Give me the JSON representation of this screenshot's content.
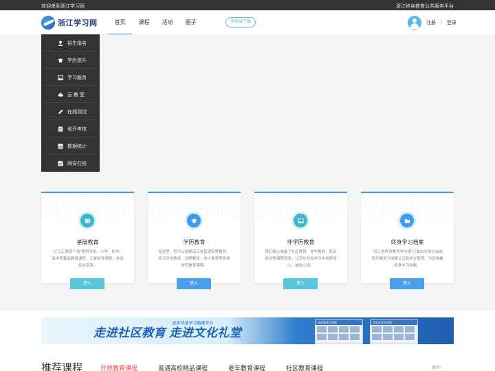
{
  "topbar": {
    "welcome": "欢迎来到浙江学习网",
    "platform": "浙江终身教育公共服务平台"
  },
  "header": {
    "logo_text": "浙江学习网",
    "nav": [
      "首页",
      "课程",
      "活动",
      "圈子"
    ],
    "download_btn": "手机端下载",
    "register": "注册",
    "separator": "|",
    "login": "登录"
  },
  "menu": {
    "items": [
      {
        "label": "招生报名",
        "icon": "user-icon"
      },
      {
        "label": "学历提升",
        "icon": "graduation-cap-icon"
      },
      {
        "label": "学习服务",
        "icon": "image-icon"
      },
      {
        "label": "云 教 室",
        "icon": "cloud-icon"
      },
      {
        "label": "在线测试",
        "icon": "pen-icon"
      },
      {
        "label": "省开考核",
        "icon": "document-icon"
      },
      {
        "label": "数据统计",
        "icon": "chart-icon"
      },
      {
        "label": "网安在线",
        "icon": "check-icon"
      }
    ]
  },
  "cards": [
    {
      "title": "基础教育",
      "desc": "“之江汇教育广场”提供学前、小学、初中、高中等基础教育课程，汇聚名师课程，共享名校资源。",
      "button": "进入",
      "icon": "library-icon"
    },
    {
      "title": "学历教育",
      "desc": "在这里，您可以选择浙江省普通高等教育、浙江开放教育、远程教育、成人教育等各类学历教育课程。",
      "button": "进入",
      "icon": "graduation-cap-icon"
    },
    {
      "title": "非学历教育",
      "desc": "我们精心准备了社区教育、老年教育、职业培训等课程资源，让您在轻松学习中修养身心，愉悦心境。",
      "button": "进入",
      "icon": "image-icon"
    },
    {
      "title": "终身学习档案",
      "desc": "“浙江省终身教育学分银行”面向全体社会成员开展学习成果认证和学分管理，为您构建终身学习档案。",
      "button": "进入",
      "icon": "folder-icon"
    }
  ],
  "banner": {
    "sub": "全民终身学习圈播平台",
    "main_left": "走进社区教育",
    "main_right": "走进文化礼堂",
    "shot1_title": "社区教育大讲堂",
    "shot2_title": "文化礼堂大讲堂"
  },
  "recommended": {
    "title": "推荐课程",
    "tabs": [
      "开放教育课程",
      "普通高校精品课程",
      "老年教育课程",
      "社区教育课程"
    ],
    "more": "更多›"
  },
  "colors": {
    "accent": "#3d9be9",
    "teal": "#5ac6d9",
    "active_tab": "#e64b3c",
    "menu_bg": "#333333"
  }
}
